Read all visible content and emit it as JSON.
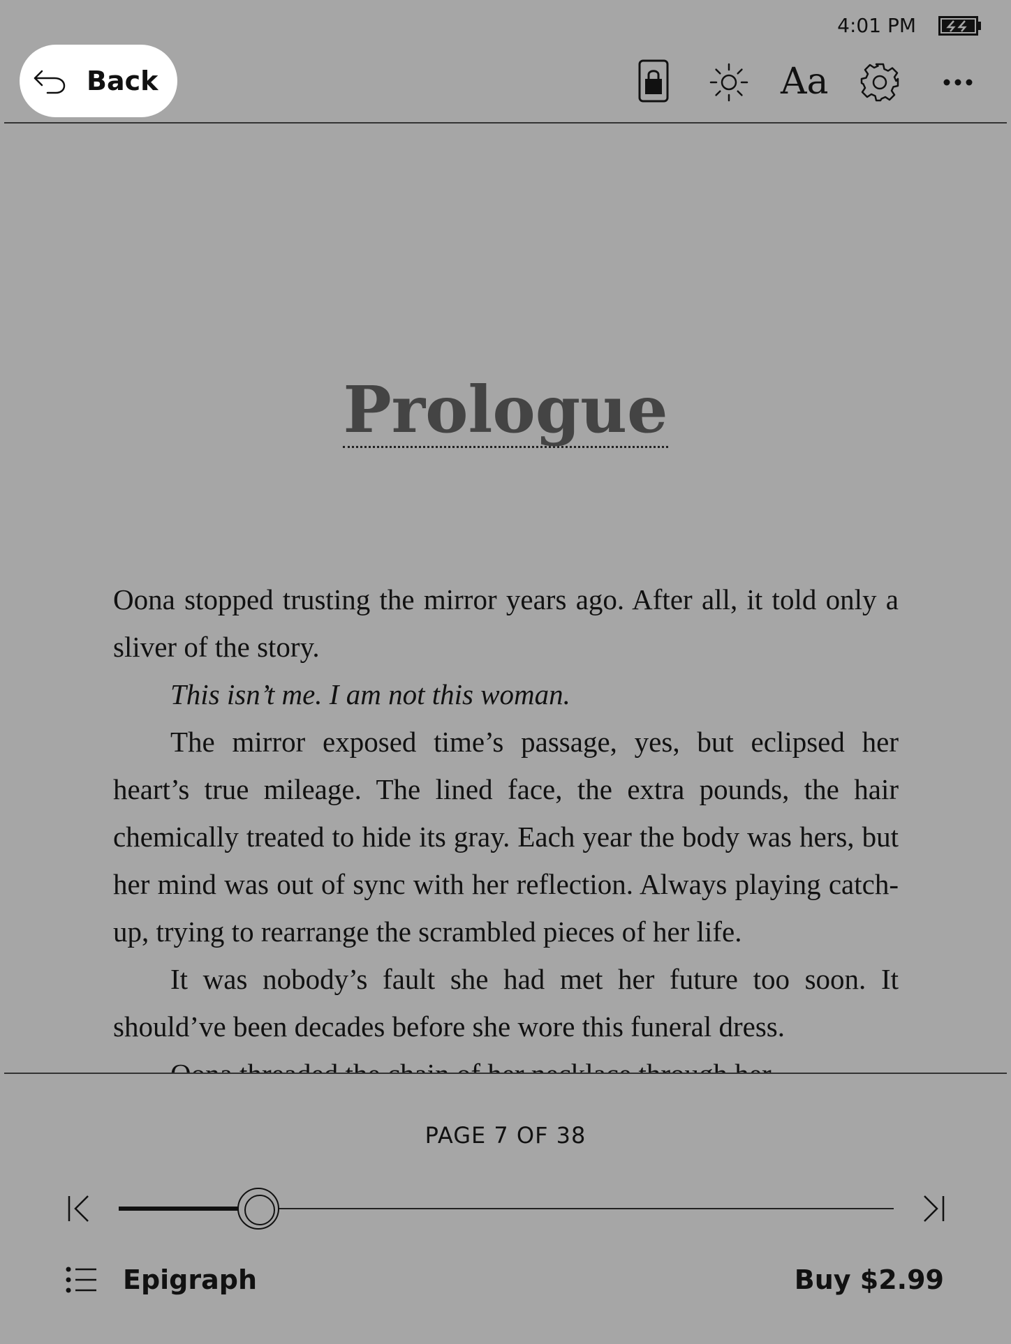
{
  "status_bar": {
    "time": "4:01 PM",
    "battery_icon": "battery-charging-icon"
  },
  "toolbar": {
    "back_label": "Back",
    "back_icon": "back-arrow-icon",
    "lock_icon": "lock-icon",
    "brightness_icon": "brightness-icon",
    "font_label": "Aa",
    "settings_icon": "gear-icon",
    "more_icon": "more-dots-icon"
  },
  "reader": {
    "chapter_title": "Prologue",
    "paragraphs": [
      {
        "text": "Oona stopped trusting the mirror years ago. After all, it told only a sliver of the story.",
        "indent": false,
        "italic": false
      },
      {
        "text": "This isn’t me. I am not this woman.",
        "indent": true,
        "italic": true
      },
      {
        "text": "The mirror exposed time’s passage, yes, but eclipsed her heart’s true mileage. The lined face, the extra pounds, the hair chemically treated to hide its gray. Each year the body was hers, but her mind was out of sync with her reflection. Always playing catch-up, trying to rearrange the scrambled pieces of her life.",
        "indent": true,
        "italic": false
      },
      {
        "text": "It was nobody’s fault she had met her future too soon. It should’ve been decades before she wore this funeral dress.",
        "indent": true,
        "italic": false
      },
      {
        "text": "Oona threaded the chain of her necklace through her",
        "indent": true,
        "italic": false
      }
    ]
  },
  "footer": {
    "page_indicator": "PAGE 7 OF 38",
    "current_page": 7,
    "total_pages": 38,
    "progress_fraction": 0.18,
    "first_page_icon": "skip-first-icon",
    "last_page_icon": "skip-last-icon",
    "toc_icon": "table-of-contents-icon",
    "section_label": "Epigraph",
    "buy_label": "Buy $2.99"
  }
}
